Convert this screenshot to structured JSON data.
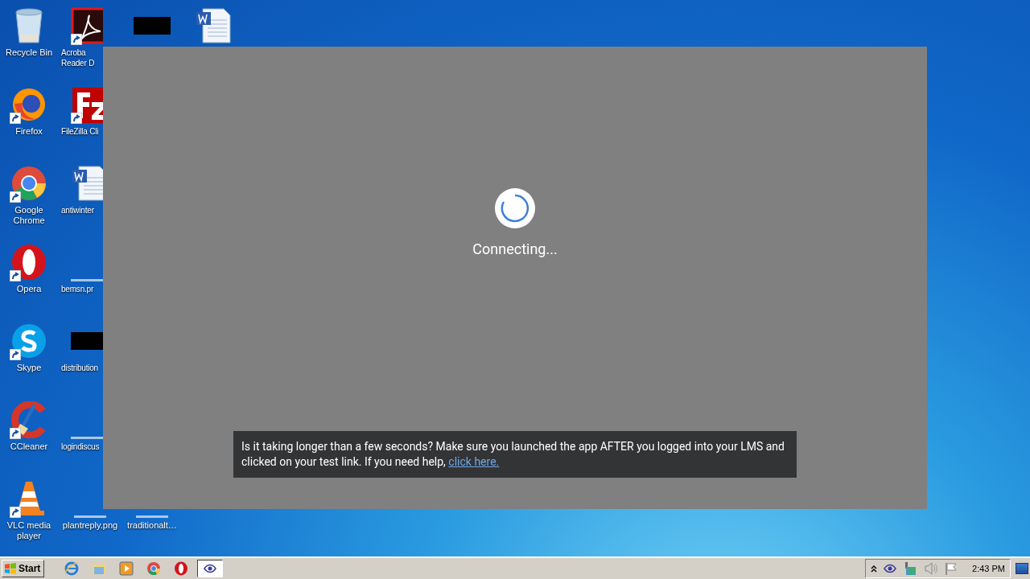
{
  "desktop_icons": [
    {
      "kind": "recycle-bin",
      "label": "Recycle Bin",
      "shortcut": false
    },
    {
      "kind": "firefox",
      "label": "Firefox",
      "shortcut": true
    },
    {
      "kind": "chrome",
      "label": "Google Chrome",
      "shortcut": true
    },
    {
      "kind": "opera",
      "label": "Opera",
      "shortcut": true
    },
    {
      "kind": "skype",
      "label": "Skype",
      "shortcut": true
    },
    {
      "kind": "ccleaner",
      "label": "CCleaner",
      "shortcut": true
    },
    {
      "kind": "vlc",
      "label": "VLC media player",
      "shortcut": true
    },
    {
      "kind": "acrobat",
      "label": "Acroba\nReader D",
      "shortcut": true
    },
    {
      "kind": "filezilla",
      "label": "FileZilla Cli",
      "shortcut": true
    },
    {
      "kind": "word",
      "label": "antiwinter",
      "shortcut": false
    },
    {
      "kind": "hidden",
      "label": "bemsn.pr",
      "shortcut": false
    },
    {
      "kind": "redacted",
      "label": "distribution",
      "shortcut": false
    },
    {
      "kind": "hidden",
      "label": "logindiscus",
      "shortcut": false
    },
    {
      "kind": "hidden",
      "label": "plantreply.png",
      "shortcut": false
    },
    {
      "kind": "redacted",
      "shortcut": false
    },
    {
      "kind": "hidden",
      "label": "traditionalt…",
      "shortcut": false
    },
    {
      "kind": "word",
      "shortcut": false
    }
  ],
  "app_window": {
    "status": "Connecting...",
    "message": {
      "text": "Is it taking longer than a few seconds? Make sure you launched the app AFTER you logged into your LMS and clicked on your test link. If you need help,",
      "link": "click here."
    }
  },
  "taskbar": {
    "start": "Start",
    "items": [
      {
        "kind": "ie",
        "selected": false
      },
      {
        "kind": "explorer",
        "selected": false
      },
      {
        "kind": "media",
        "selected": false
      },
      {
        "kind": "chrome",
        "selected": false
      },
      {
        "kind": "opera",
        "selected": false
      },
      {
        "kind": "eye",
        "selected": true
      }
    ],
    "tray": [
      {
        "kind": "chevron"
      },
      {
        "kind": "eye"
      },
      {
        "kind": "network"
      },
      {
        "kind": "volume"
      },
      {
        "kind": "flag"
      }
    ],
    "clock": "2:43 PM"
  }
}
